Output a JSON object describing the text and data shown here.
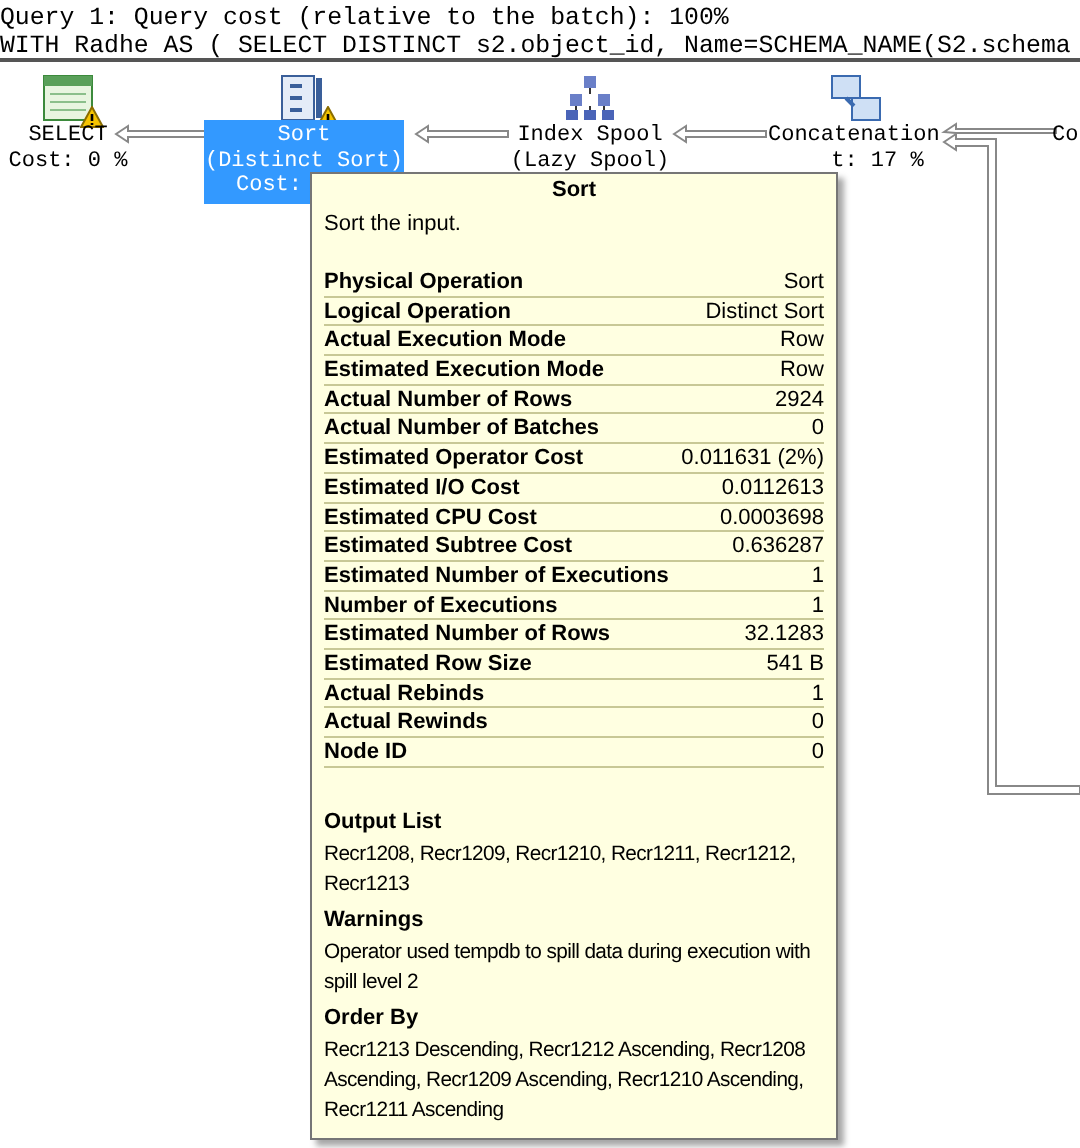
{
  "header": {
    "query_line": "Query 1: Query cost (relative to the batch): 100%",
    "sql_line": "WITH Radhe AS ( SELECT DISTINCT s2.object_id, Name=SCHEMA_NAME(S2.schema"
  },
  "nodes": [
    {
      "kind": "select",
      "lines": [
        "SELECT",
        "Cost: 0 %"
      ],
      "selected": false,
      "warning": true
    },
    {
      "kind": "sort",
      "lines": [
        "Sort",
        "(Distinct Sort)",
        "Cost:"
      ],
      "selected": true,
      "warning": true
    },
    {
      "kind": "spool",
      "lines": [
        "Index Spool",
        "(Lazy Spool)"
      ],
      "selected": false,
      "warning": false
    },
    {
      "kind": "concat",
      "lines": [
        "Concatenation",
        "t: 17 %"
      ],
      "selected": false,
      "warning": false
    },
    {
      "kind": "partial",
      "lines": [
        "Co"
      ],
      "selected": false
    }
  ],
  "tooltip": {
    "title": "Sort",
    "description": "Sort the input.",
    "properties": [
      {
        "name": "Physical Operation",
        "value": "Sort"
      },
      {
        "name": "Logical Operation",
        "value": "Distinct Sort"
      },
      {
        "name": "Actual Execution Mode",
        "value": "Row"
      },
      {
        "name": "Estimated Execution Mode",
        "value": "Row"
      },
      {
        "name": "Actual Number of Rows",
        "value": "2924"
      },
      {
        "name": "Actual Number of Batches",
        "value": "0"
      },
      {
        "name": "Estimated Operator Cost",
        "value": "0.011631 (2%)"
      },
      {
        "name": "Estimated I/O Cost",
        "value": "0.0112613"
      },
      {
        "name": "Estimated CPU Cost",
        "value": "0.0003698"
      },
      {
        "name": "Estimated Subtree Cost",
        "value": "0.636287"
      },
      {
        "name": "Estimated Number of Executions",
        "value": "1"
      },
      {
        "name": "Number of Executions",
        "value": "1"
      },
      {
        "name": "Estimated Number of Rows",
        "value": "32.1283"
      },
      {
        "name": "Estimated Row Size",
        "value": "541 B"
      },
      {
        "name": "Actual Rebinds",
        "value": "1"
      },
      {
        "name": "Actual Rewinds",
        "value": "0"
      },
      {
        "name": "Node ID",
        "value": "0"
      }
    ],
    "sections": [
      {
        "heading": "Output List",
        "text": "Recr1208, Recr1209, Recr1210, Recr1211, Recr1212, Recr1213"
      },
      {
        "heading": "Warnings",
        "text": "Operator used tempdb to spill data during execution with spill level 2"
      },
      {
        "heading": "Order By",
        "text": "Recr1213 Descending, Recr1212 Ascending, Recr1208 Ascending, Recr1209 Ascending, Recr1210 Ascending, Recr1211 Ascending"
      }
    ]
  }
}
